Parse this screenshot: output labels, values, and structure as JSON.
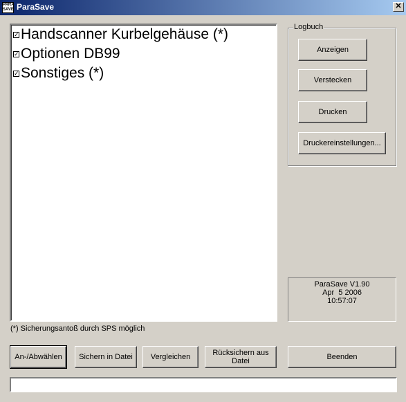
{
  "window": {
    "title": "ParaSave",
    "app_icon_text": "PARA SAVE",
    "close_glyph": "✕"
  },
  "list": {
    "items": [
      {
        "label": "Handscanner Kurbelgehäuse (*)",
        "checked": true
      },
      {
        "label": "Optionen DB99",
        "checked": true
      },
      {
        "label": "Sonstiges (*)",
        "checked": true
      }
    ]
  },
  "footnote": "(*) Sicherungsantoß durch SPS möglich",
  "logbuch": {
    "legend": "Logbuch",
    "buttons": {
      "anzeigen": "Anzeigen",
      "verstecken": "Verstecken",
      "drucken": "Drucken",
      "druckereinstellungen": "Druckereinstellungen..."
    }
  },
  "version": {
    "line1": "ParaSave V1.90",
    "line2": "Apr  5 2006",
    "line3": "10:57:07"
  },
  "bottom_buttons": {
    "an_abwaehlen": "An-/Abwählen",
    "sichern": "Sichern in Datei",
    "vergleichen": "Vergleichen",
    "ruecksichern": "Rücksichern aus Datei",
    "beenden": "Beenden"
  },
  "status_field": {
    "value": ""
  },
  "colors": {
    "face": "#d4d0c8",
    "titlebar_start": "#0a246a",
    "titlebar_end": "#a6caf0"
  }
}
